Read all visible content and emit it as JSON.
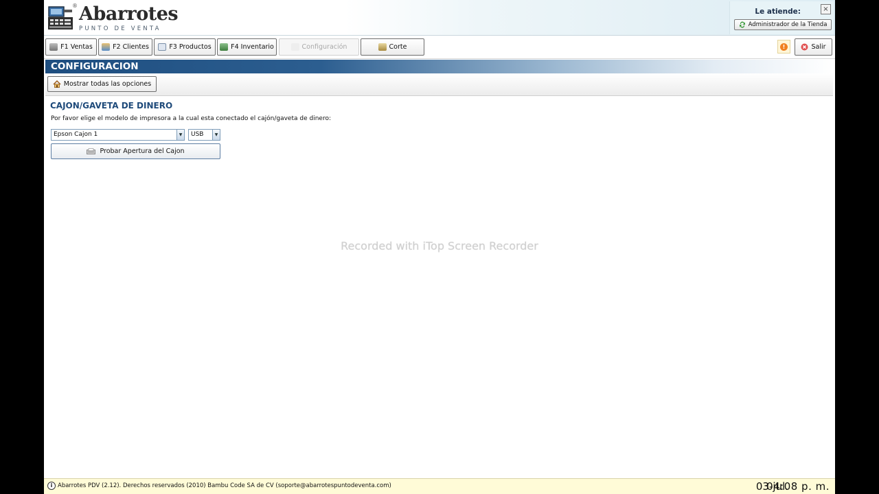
{
  "header": {
    "logo_title": "Abarrotes",
    "logo_registered": "®",
    "logo_subtitle": "PUNTO DE VENTA",
    "attend_label": "Le atiende:",
    "user_button": "Administrador de la Tienda",
    "close_glyph": "×"
  },
  "toolbar": {
    "buttons": [
      {
        "label": "F1 Ventas",
        "icon": "cart-icon"
      },
      {
        "label": "F2 Clientes",
        "icon": "clients-icon"
      },
      {
        "label": "F3 Productos",
        "icon": "products-icon"
      },
      {
        "label": "F4 Inventario",
        "icon": "inventory-icon"
      },
      {
        "label": "Configuración",
        "icon": "config-icon",
        "disabled": true
      },
      {
        "label": "Corte",
        "icon": "cut-icon"
      }
    ],
    "alert_glyph": "!",
    "exit_label": "Salir"
  },
  "section": {
    "title": "CONFIGURACION",
    "show_all_label": "Mostrar todas las opciones"
  },
  "drawer": {
    "title": "CAJON/GAVETA DE DINERO",
    "description": "Por favor  elige el modelo de impresora a la cual esta conectado el cajón/gaveta de dinero:",
    "printer_value": "Epson Cajon 1",
    "port_value": "USB",
    "test_button": "Probar Apertura del Cajon"
  },
  "watermark": "Recorded with iTop Screen Recorder",
  "footer": {
    "info": "Abarrotes PDV (2.12). Derechos reservados (2010) Bambu Code SA de CV (soporte@abarrotespuntodeventa.com)",
    "date": "03-jul.",
    "time": "04:08 p. m."
  },
  "colors": {
    "section_bar": "#1e4e80",
    "drawer_title": "#1e4a7a",
    "footer_bg": "#fffbd7"
  }
}
